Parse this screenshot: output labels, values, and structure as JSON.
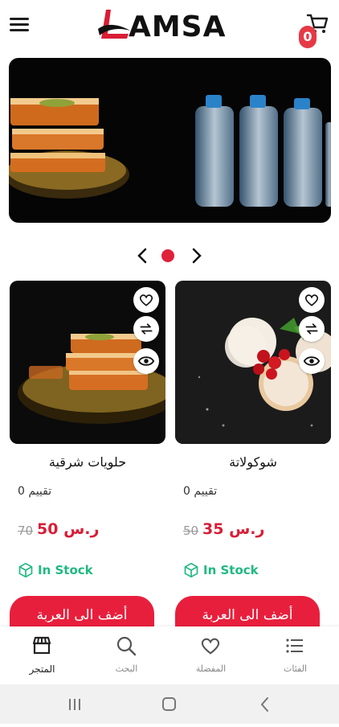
{
  "header": {
    "logo_text": "AMSA",
    "cart_count": "0"
  },
  "banner": {
    "slide_index": 1,
    "slide_count": 1
  },
  "products": [
    {
      "name": "حلويات شرقية",
      "rating_text": "تقييم 0",
      "old_price": "70",
      "new_price": "ر.س 50",
      "stock": "In Stock",
      "add_label": "أضف الى العربة"
    },
    {
      "name": "شوكولاتة",
      "rating_text": "تقييم 0",
      "old_price": "50",
      "new_price": "ر.س 35",
      "stock": "In Stock",
      "add_label": "أضف الى العربة"
    }
  ],
  "bottom_nav": [
    {
      "label": "المتجر",
      "icon": "store-icon",
      "active": true
    },
    {
      "label": "البحث",
      "icon": "search-icon",
      "active": false
    },
    {
      "label": "المفضلة",
      "icon": "heart-icon",
      "active": false
    },
    {
      "label": "الفئات",
      "icon": "list-icon",
      "active": false
    }
  ],
  "colors": {
    "accent": "#e81f3c",
    "stock_green": "#1fb980"
  }
}
